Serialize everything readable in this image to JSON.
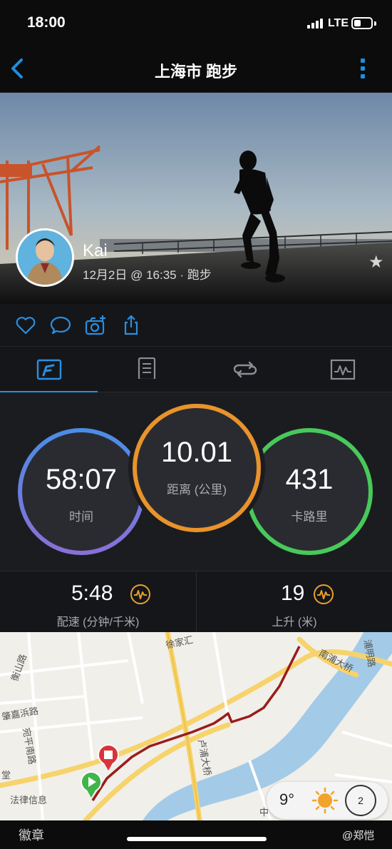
{
  "status_bar": {
    "time": "18:00",
    "network": "LTE",
    "battery_fraction": 0.3
  },
  "header": {
    "title": "上海市 跑步",
    "back_icon": "chevron-left-icon",
    "more_icon": "more-vertical-icon"
  },
  "activity": {
    "user_name": "Kai",
    "meta": "12月2日 @ 16:35 · 跑步",
    "favorite_icon": "star-icon"
  },
  "actions": [
    "heart-icon",
    "comment-icon",
    "add-photo-icon",
    "share-icon"
  ],
  "tabs": [
    "summary-icon",
    "details-icon",
    "laps-icon",
    "charts-icon"
  ],
  "stats": {
    "time": {
      "value": "58:07",
      "label": "时间",
      "color": "#4a8de6"
    },
    "distance": {
      "value": "10.01",
      "label": "距离 (公里)",
      "color": "#e8932b"
    },
    "calories": {
      "value": "431",
      "label": "卡路里",
      "color": "#48c95a"
    }
  },
  "metrics": {
    "pace": {
      "value": "5:48",
      "label": "配速 (分钟/千米)"
    },
    "ascent": {
      "value": "19",
      "label": "上升 (米)"
    }
  },
  "map": {
    "labels": {
      "xujiahui": "徐家汇",
      "hengshan": "衡山路",
      "zhaojiabang": "肇嘉浜路",
      "wanping": "宛平南路",
      "fazheng": "法律信息",
      "lupu": "卢浦大桥",
      "nanpu": "南浦大桥",
      "pudong": "浦明路",
      "hall": "堂",
      "zhong": "中"
    },
    "route_color": "#9a1c1c"
  },
  "weather": {
    "temperature": "9°",
    "wind": "2"
  },
  "bottom": {
    "label": "徽章",
    "watermark": "@郑恺"
  }
}
